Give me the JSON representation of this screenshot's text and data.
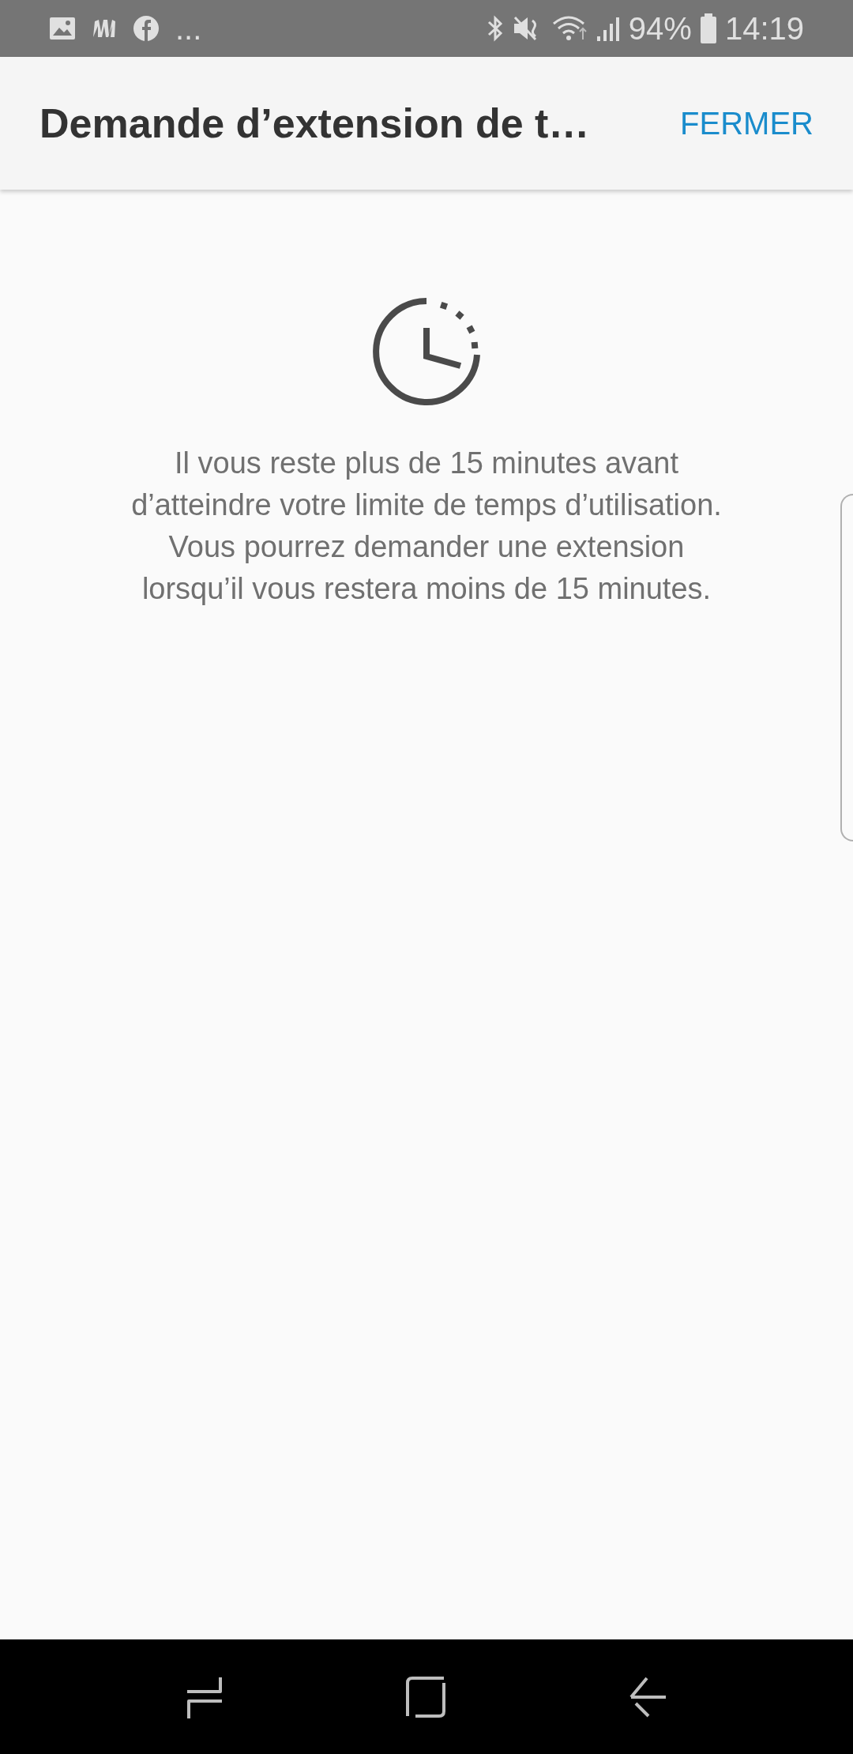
{
  "status_bar": {
    "more": "...",
    "battery": "94%",
    "time": "14:19"
  },
  "header": {
    "title": "Demande d’extension de t…",
    "action": "FERMER"
  },
  "message": [
    "Il vous reste plus de 15 minutes avant",
    "d’atteindre votre limite de temps d’utilisation.",
    "Vous pourrez demander une extension",
    "lorsqu’il vous restera moins de 15 minutes."
  ]
}
